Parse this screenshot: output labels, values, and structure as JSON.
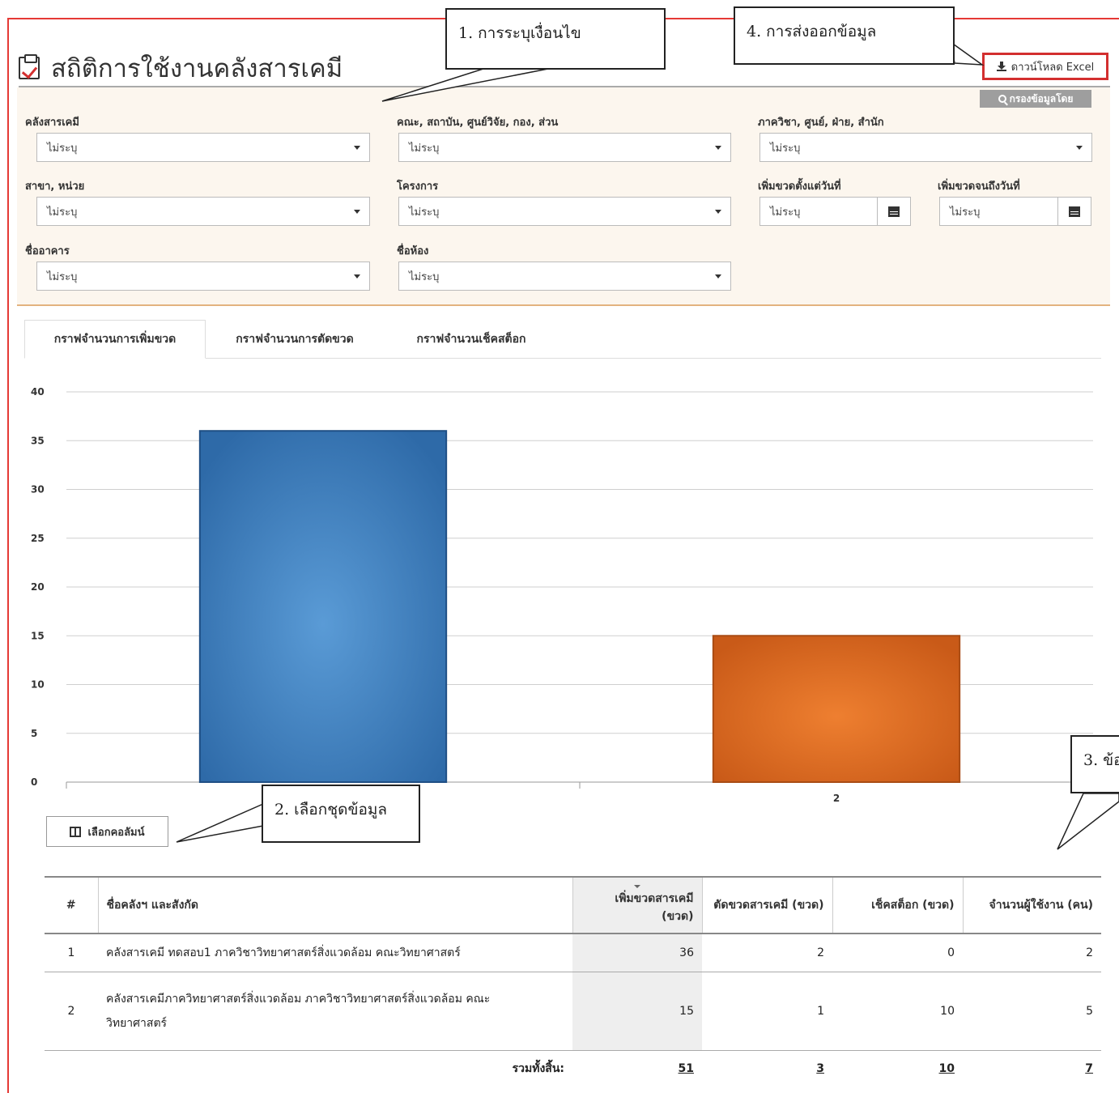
{
  "page": {
    "title": "สถิติการใช้งานคลังสารเคมี"
  },
  "toolbar": {
    "excel_label": "ดาวน์โหลด Excel",
    "filter_label": "กรองข้อมูลโดย"
  },
  "callouts": {
    "c1": "1. การระบุเงื่อนไข",
    "c2": "2. เลือกชุดข้อมูล",
    "c3": "3. ข้อ",
    "c4": "4. การส่งออกข้อมูล"
  },
  "filters": {
    "store": {
      "label": "คลังสารเคมี",
      "value": "ไม่ระบุ"
    },
    "faculty": {
      "label": "คณะ, สถาบัน, ศูนย์วิจัย, กอง, ส่วน",
      "value": "ไม่ระบุ"
    },
    "department": {
      "label": "ภาควิชา, ศูนย์, ฝ่าย, สำนัก",
      "value": "ไม่ระบุ"
    },
    "branch": {
      "label": "สาขา, หน่วย",
      "value": "ไม่ระบุ"
    },
    "project": {
      "label": "โครงการ",
      "value": "ไม่ระบุ"
    },
    "date_from": {
      "label": "เพิ่มขวดตั้งแต่วันที่",
      "value": "ไม่ระบุ"
    },
    "date_to": {
      "label": "เพิ่มขวดจนถึงวันที่",
      "value": "ไม่ระบุ"
    },
    "building": {
      "label": "ชื่ออาคาร",
      "value": "ไม่ระบุ"
    },
    "room": {
      "label": "ชื่อห้อง",
      "value": "ไม่ระบุ"
    }
  },
  "tabs": [
    {
      "label": "กราฟจำนวนการเพิ่มขวด"
    },
    {
      "label": "กราฟจำนวนการตัดขวด"
    },
    {
      "label": "กราฟจำนวนเช็คสต็อก"
    }
  ],
  "column_select_label": "เลือกคอลัมน์",
  "chart_data": {
    "type": "bar",
    "categories": [
      "",
      "2"
    ],
    "values": [
      36,
      15
    ],
    "colors": [
      "#3f82c4",
      "#e0712a"
    ],
    "ylim": [
      0,
      40
    ],
    "yticks": [
      0,
      5,
      10,
      15,
      20,
      25,
      30,
      35,
      40
    ],
    "grid": true
  },
  "table": {
    "headers": {
      "no": "#",
      "name": "ชื่อคลังฯ และสังกัด",
      "add": "เพิ่มขวดสารเคมี (ขวด)",
      "cut": "ตัดขวดสารเคมี (ขวด)",
      "check": "เช็คสต็อก (ขวด)",
      "users": "จำนวนผู้ใช้งาน (คน)"
    },
    "rows": [
      {
        "no": "1",
        "name": "คลังสารเคมี ทดสอบ1 ภาควิชาวิทยาศาสตร์สิ่งแวดล้อม คณะวิทยาศาสตร์",
        "add": "36",
        "cut": "2",
        "check": "0",
        "users": "2"
      },
      {
        "no": "2",
        "name": "คลังสารเคมีภาควิทยาศาสตร์สิ่งแวดล้อม ภาควิชาวิทยาศาสตร์สิ่งแวดล้อม คณะวิทยาศาสตร์",
        "add": "15",
        "cut": "1",
        "check": "10",
        "users": "5"
      }
    ],
    "footer": {
      "label": "รวมทั้งสิ้น:",
      "add": "51",
      "cut": "3",
      "check": "10",
      "users": "7"
    }
  },
  "colors": {
    "frame": "#e53935",
    "panel_bg": "#fcf6ee",
    "panel_border": "#e3b37f",
    "filter_button": "#9e9e9e"
  }
}
